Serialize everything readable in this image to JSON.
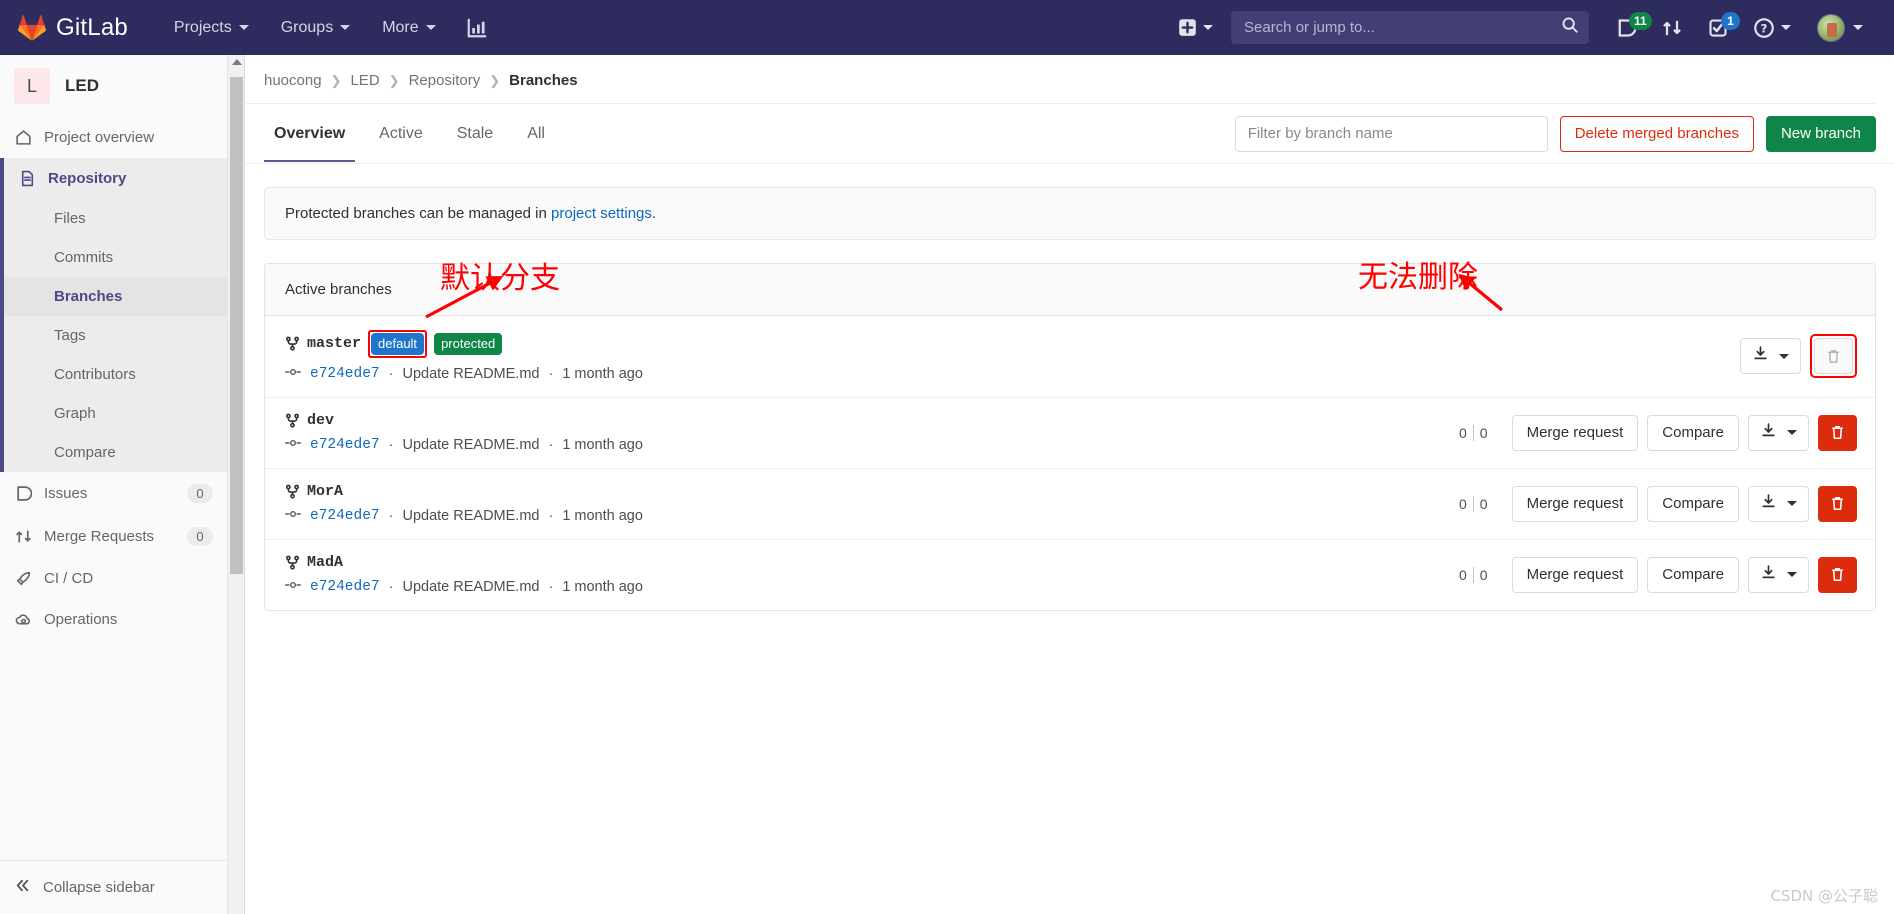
{
  "navbar": {
    "brand": "GitLab",
    "items": [
      {
        "label": "Projects",
        "icon": "chevron-down-icon"
      },
      {
        "label": "Groups",
        "icon": "chevron-down-icon"
      },
      {
        "label": "More",
        "icon": "chevron-down-icon"
      }
    ],
    "analytics_icon": "chart-bar-icon",
    "create_new_icon": "plus-square-icon",
    "search": {
      "placeholder": "Search or jump to...",
      "value": "",
      "icon": "search-icon"
    },
    "issues_icon": "issues-icon",
    "issues_count": "11",
    "merge_requests_icon": "merge-request-icon",
    "todos_icon": "todo-checkbox-icon",
    "todos_count": "1",
    "help_icon": "help-circle-icon",
    "avatar_icon": "user-avatar"
  },
  "sidebar": {
    "project": {
      "initial": "L",
      "name": "LED"
    },
    "overview": {
      "label": "Project overview",
      "icon": "home-icon"
    },
    "repository": {
      "label": "Repository",
      "icon": "document-icon"
    },
    "repository_subitems": [
      {
        "label": "Files",
        "active": false
      },
      {
        "label": "Commits",
        "active": false
      },
      {
        "label": "Branches",
        "active": true
      },
      {
        "label": "Tags",
        "active": false
      },
      {
        "label": "Contributors",
        "active": false
      },
      {
        "label": "Graph",
        "active": false
      },
      {
        "label": "Compare",
        "active": false
      }
    ],
    "items": [
      {
        "label": "Issues",
        "icon": "issues-icon",
        "count": "0"
      },
      {
        "label": "Merge Requests",
        "icon": "merge-request-icon",
        "count": "0"
      },
      {
        "label": "CI / CD",
        "icon": "rocket-icon",
        "count": ""
      },
      {
        "label": "Operations",
        "icon": "cloud-gear-icon",
        "count": ""
      }
    ],
    "collapse": {
      "label": "Collapse sidebar",
      "icon": "chevron-double-left-icon"
    }
  },
  "breadcrumb": [
    {
      "label": "huocong"
    },
    {
      "label": "LED"
    },
    {
      "label": "Repository"
    },
    {
      "label": "Branches"
    }
  ],
  "tabs": [
    {
      "label": "Overview",
      "active": true
    },
    {
      "label": "Active",
      "active": false
    },
    {
      "label": "Stale",
      "active": false
    },
    {
      "label": "All",
      "active": false
    }
  ],
  "toolbar": {
    "filter_placeholder": "Filter by branch name",
    "filter_value": "",
    "delete_merged_label": "Delete merged branches",
    "new_branch_label": "New branch"
  },
  "notice": {
    "text_before": "Protected branches can be managed in ",
    "link": "project settings",
    "text_after": "."
  },
  "panel": {
    "header": "Active branches",
    "branches": [
      {
        "name": "master",
        "badges": [
          {
            "label": "default",
            "type": "default",
            "highlighted": true
          },
          {
            "label": "protected",
            "type": "protected",
            "highlighted": false
          }
        ],
        "commit_sha": "e724ede7",
        "commit_message": "Update README.md",
        "commit_time": "1 month ago",
        "behind": "",
        "ahead": "",
        "show_merge_request": false,
        "show_compare": false,
        "delete_enabled": false,
        "delete_highlighted": true
      },
      {
        "name": "dev",
        "badges": [],
        "commit_sha": "e724ede7",
        "commit_message": "Update README.md",
        "commit_time": "1 month ago",
        "behind": "0",
        "ahead": "0",
        "show_merge_request": true,
        "show_compare": true,
        "delete_enabled": true,
        "delete_highlighted": false
      },
      {
        "name": "MorA",
        "badges": [],
        "commit_sha": "e724ede7",
        "commit_message": "Update README.md",
        "commit_time": "1 month ago",
        "behind": "0",
        "ahead": "0",
        "show_merge_request": true,
        "show_compare": true,
        "delete_enabled": true,
        "delete_highlighted": false
      },
      {
        "name": "MadA",
        "badges": [],
        "commit_sha": "e724ede7",
        "commit_message": "Update README.md",
        "commit_time": "1 month ago",
        "behind": "0",
        "ahead": "0",
        "show_merge_request": true,
        "show_compare": true,
        "delete_enabled": true,
        "delete_highlighted": false
      }
    ],
    "row_labels": {
      "merge_request": "Merge request",
      "compare": "Compare",
      "download_icon": "download-icon",
      "delete_icon": "trash-icon"
    }
  },
  "annotations": {
    "default_branch": "默认分支",
    "cannot_delete": "无法删除"
  },
  "watermark": "CSDN @公子聪",
  "colors": {
    "navbar_bg": "#2e2c5e",
    "accent_purple": "#4b4a85",
    "link_blue": "#1068bf",
    "badge_blue": "#1f75cb",
    "badge_green": "#108548",
    "danger_red": "#dd2b0e",
    "annotation_red": "#ff0000"
  }
}
